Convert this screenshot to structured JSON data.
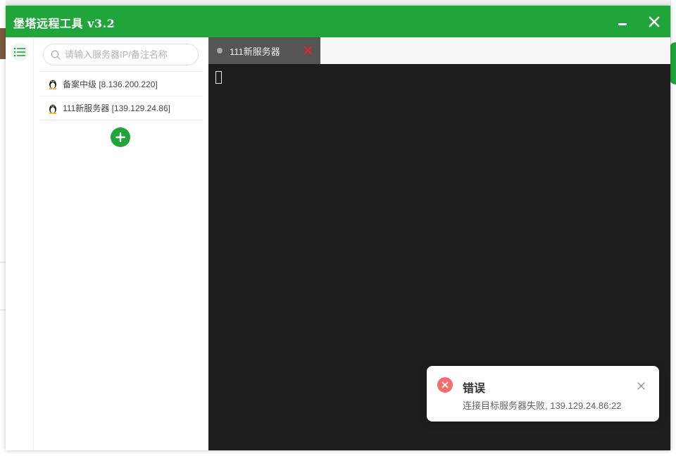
{
  "window": {
    "title": "堡塔远程工具 v3.2",
    "accent_color": "#20a53a"
  },
  "sidebar": {
    "menu_icon": "list-icon",
    "search_placeholder": "请输入服务器IP/备注名称",
    "servers": [
      {
        "label": "备案中级 [8.136.200.220]",
        "icon": "linux-tux-icon"
      },
      {
        "label": "111新服务器 [139.129.24.86]",
        "icon": "linux-tux-icon"
      }
    ],
    "add_icon": "plus-circle-icon"
  },
  "tabs": [
    {
      "label": "111新服务器",
      "status_color": "#a9a9a9",
      "close_icon": "close-icon"
    }
  ],
  "terminal": {
    "background": "#1e1e1e"
  },
  "notification": {
    "type": "error",
    "title": "错误",
    "message": "连接目标服务器失败, 139.129.24.86:22",
    "icon": "error-circle-icon",
    "color": "#f56c6c"
  }
}
